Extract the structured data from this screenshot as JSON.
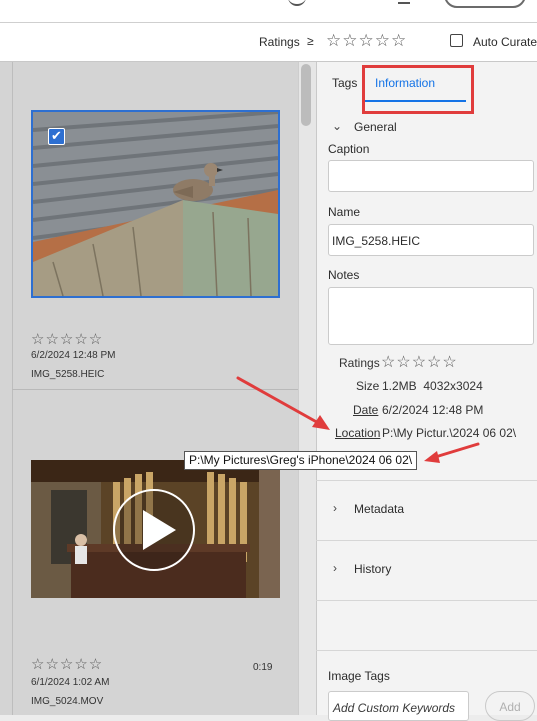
{
  "toolbar": {
    "ratings_label": "Ratings",
    "ratings_operator": "≥",
    "ratings_stars": "☆☆☆☆☆",
    "auto_curate_label": "Auto Curate"
  },
  "grid": {
    "items": [
      {
        "stars": "☆☆☆☆☆",
        "date": "6/2/2024 12:48 PM",
        "filename": "IMG_5258.HEIC",
        "selected": true
      },
      {
        "stars": "☆☆☆☆☆",
        "date": "6/1/2024 1:02 AM",
        "filename": "IMG_5024.MOV",
        "duration": "0:19"
      }
    ]
  },
  "panel": {
    "tabs": [
      {
        "label": "Tags",
        "active": false
      },
      {
        "label": "Information",
        "active": true
      }
    ],
    "general": {
      "heading": "General",
      "caption_label": "Caption",
      "caption_value": "",
      "name_label": "Name",
      "name_value": "IMG_5258.HEIC",
      "notes_label": "Notes",
      "notes_value": "",
      "ratings_label": "Ratings",
      "ratings_stars": "☆☆☆☆☆",
      "size_label": "Size",
      "size_value": "1.2MB  4032x3024",
      "date_label": "Date",
      "date_value": "6/2/2024 12:48 PM",
      "location_label": "Location",
      "location_value": "P:\\My Pictur.\\2024 06 02\\"
    },
    "metadata_heading": "Metadata",
    "history_heading": "History",
    "image_tags_label": "Image Tags",
    "keywords_placeholder": "Add Custom Keywords",
    "add_button": "Add"
  },
  "tooltip": "P:\\My Pictures\\Greg's iPhone\\2024 06 02\\",
  "colors": {
    "accent": "#1473e6",
    "annotation_red": "#e03c3c",
    "selection": "#2d6fd1"
  }
}
